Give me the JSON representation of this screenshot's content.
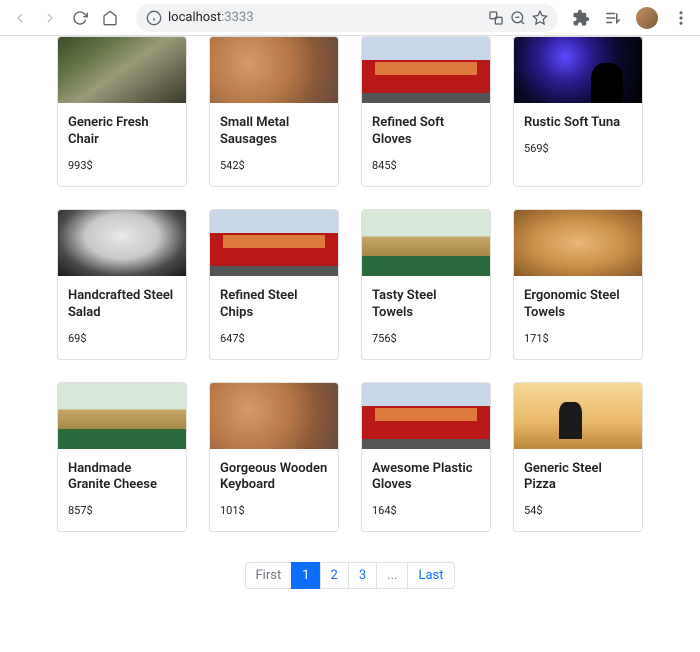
{
  "browser": {
    "url_host": "localhost",
    "url_port": ":3333"
  },
  "products": [
    {
      "title": "Generic Fresh Chair",
      "price": "993$",
      "img": "img-rock"
    },
    {
      "title": "Small Metal Sausages",
      "price": "542$",
      "img": "img-painting"
    },
    {
      "title": "Refined Soft Gloves",
      "price": "845$",
      "img": "img-bus"
    },
    {
      "title": "Rustic Soft Tuna",
      "price": "569$",
      "img": "img-concert"
    },
    {
      "title": "Handcrafted Steel Salad",
      "price": "69$",
      "img": "img-earbuds"
    },
    {
      "title": "Refined Steel Chips",
      "price": "647$",
      "img": "img-bus"
    },
    {
      "title": "Tasty Steel Towels",
      "price": "756$",
      "img": "img-office"
    },
    {
      "title": "Ergonomic Steel Towels",
      "price": "171$",
      "img": "img-bread"
    },
    {
      "title": "Handmade Granite Cheese",
      "price": "857$",
      "img": "img-office"
    },
    {
      "title": "Gorgeous Wooden Keyboard",
      "price": "101$",
      "img": "img-painting"
    },
    {
      "title": "Awesome Plastic Gloves",
      "price": "164$",
      "img": "img-bus"
    },
    {
      "title": "Generic Steel Pizza",
      "price": "54$",
      "img": "img-cricket"
    }
  ],
  "pagination": {
    "first": "First",
    "pages": [
      "1",
      "2",
      "3"
    ],
    "ellipsis": "...",
    "last": "Last",
    "active_index": 0
  }
}
